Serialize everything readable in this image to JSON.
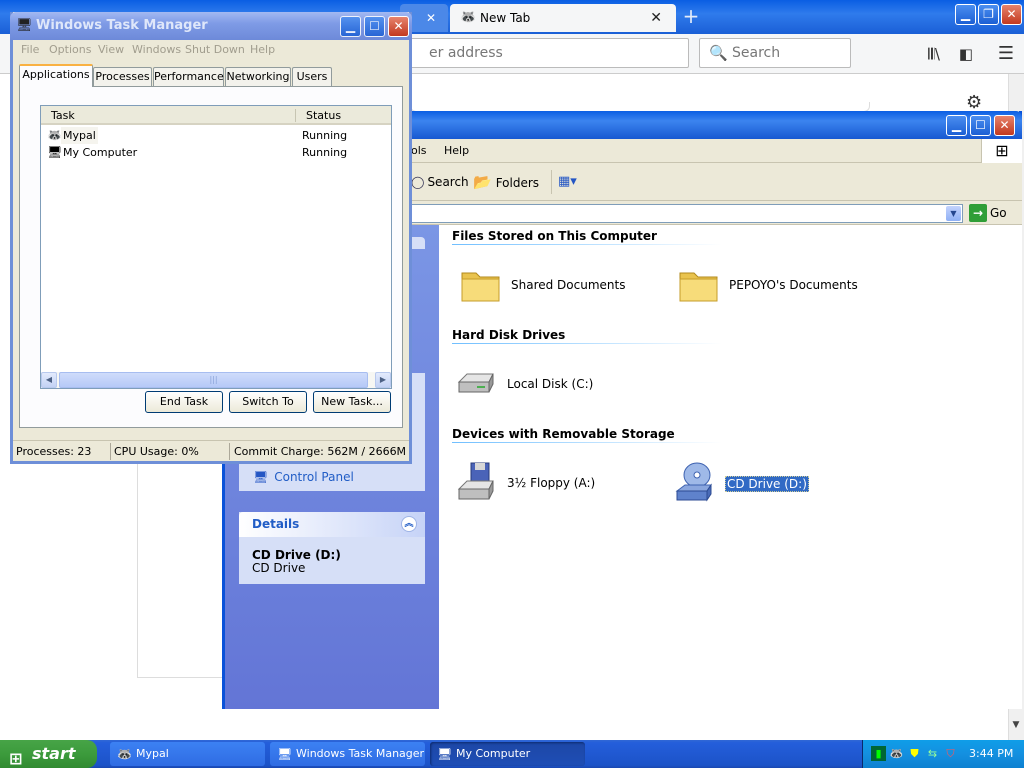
{
  "firefox": {
    "tab_new": "New Tab",
    "tab_close_glyph": "✕",
    "newtab_glyph": "+",
    "urlbar_placeholder": "er address",
    "search_placeholder": "Search",
    "icons": {
      "library": "library-icon",
      "sidebar": "sidebar-icon",
      "menu": "hamburger-menu-icon",
      "gear": "gear-icon"
    }
  },
  "my_computer": {
    "menu": {
      "tools": "ols",
      "help": "Help"
    },
    "toolbar": {
      "search": "Search",
      "folders": "Folders"
    },
    "address_go": "Go",
    "sidebar": {
      "control_panel": "Control Panel"
    },
    "details": {
      "header": "Details",
      "name": "CD Drive (D:)",
      "type": "CD Drive"
    },
    "groups": [
      {
        "title": "Files Stored on This Computer",
        "items": [
          "Shared Documents",
          "PEPOYO's Documents"
        ]
      },
      {
        "title": "Hard Disk Drives",
        "items": [
          "Local Disk (C:)"
        ]
      },
      {
        "title": "Devices with Removable Storage",
        "items": [
          "3½ Floppy (A:)",
          "CD Drive (D:)"
        ]
      }
    ],
    "selected_item": "CD Drive (D:)"
  },
  "task_manager": {
    "title": "Windows Task Manager",
    "menu": [
      "File",
      "Options",
      "View",
      "Windows",
      "Shut Down",
      "Help"
    ],
    "tabs": [
      "Applications",
      "Processes",
      "Performance",
      "Networking",
      "Users"
    ],
    "active_tab": "Applications",
    "columns": {
      "task": "Task",
      "status": "Status"
    },
    "rows": [
      {
        "task": "Mypal",
        "status": "Running"
      },
      {
        "task": "My Computer",
        "status": "Running"
      }
    ],
    "buttons": {
      "end_task": "End Task",
      "switch_to": "Switch To",
      "new_task": "New Task..."
    },
    "status": {
      "processes": "Processes: 23",
      "cpu": "CPU Usage: 0%",
      "commit": "Commit Charge: 562M / 2666M"
    }
  },
  "taskbar": {
    "start": "start",
    "tasks": [
      "Mypal",
      "Windows Task Manager",
      "My Computer"
    ],
    "active_task": "My Computer",
    "clock": "3:44 PM"
  }
}
